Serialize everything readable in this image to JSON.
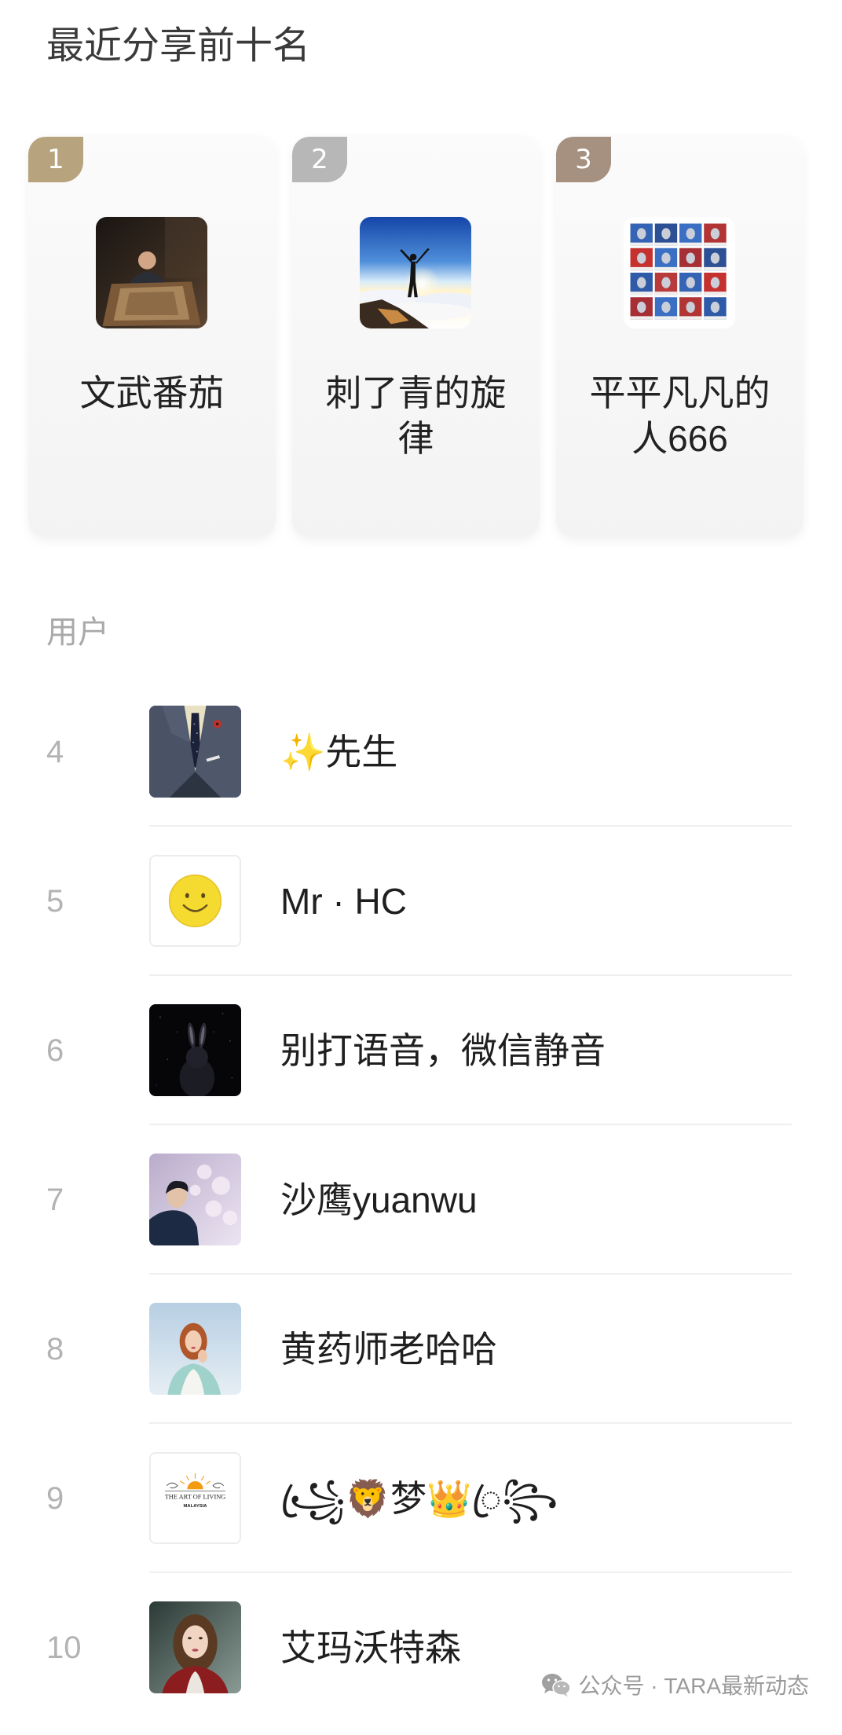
{
  "title": "最近分享前十名",
  "top_three": [
    {
      "rank": "1",
      "name": "文武番茄",
      "badge_color": "#b7a37d"
    },
    {
      "rank": "2",
      "name": "刺了青的旋律",
      "badge_color": "#b7b7b7"
    },
    {
      "rank": "3",
      "name": "平平凡凡的人666",
      "badge_color": "#a69080"
    }
  ],
  "section_label": "用户",
  "users": [
    {
      "rank": "4",
      "name": "✨先生"
    },
    {
      "rank": "5",
      "name": "Mr · HC"
    },
    {
      "rank": "6",
      "name": "别打语音，微信静音"
    },
    {
      "rank": "7",
      "name": "沙鹰yuanwu"
    },
    {
      "rank": "8",
      "name": "黄药师老哈哈"
    },
    {
      "rank": "9",
      "name": "꧁ꦿ🦁梦👑ꦿ꧂",
      "avatar_logo": {
        "line1": "THE ART OF LIVING",
        "line2": "MALAYSIA"
      }
    },
    {
      "rank": "10",
      "name": "艾玛沃特森"
    }
  ],
  "watermark": {
    "icon": "wechat-icon",
    "text": "公众号 · TARA最新动态"
  }
}
